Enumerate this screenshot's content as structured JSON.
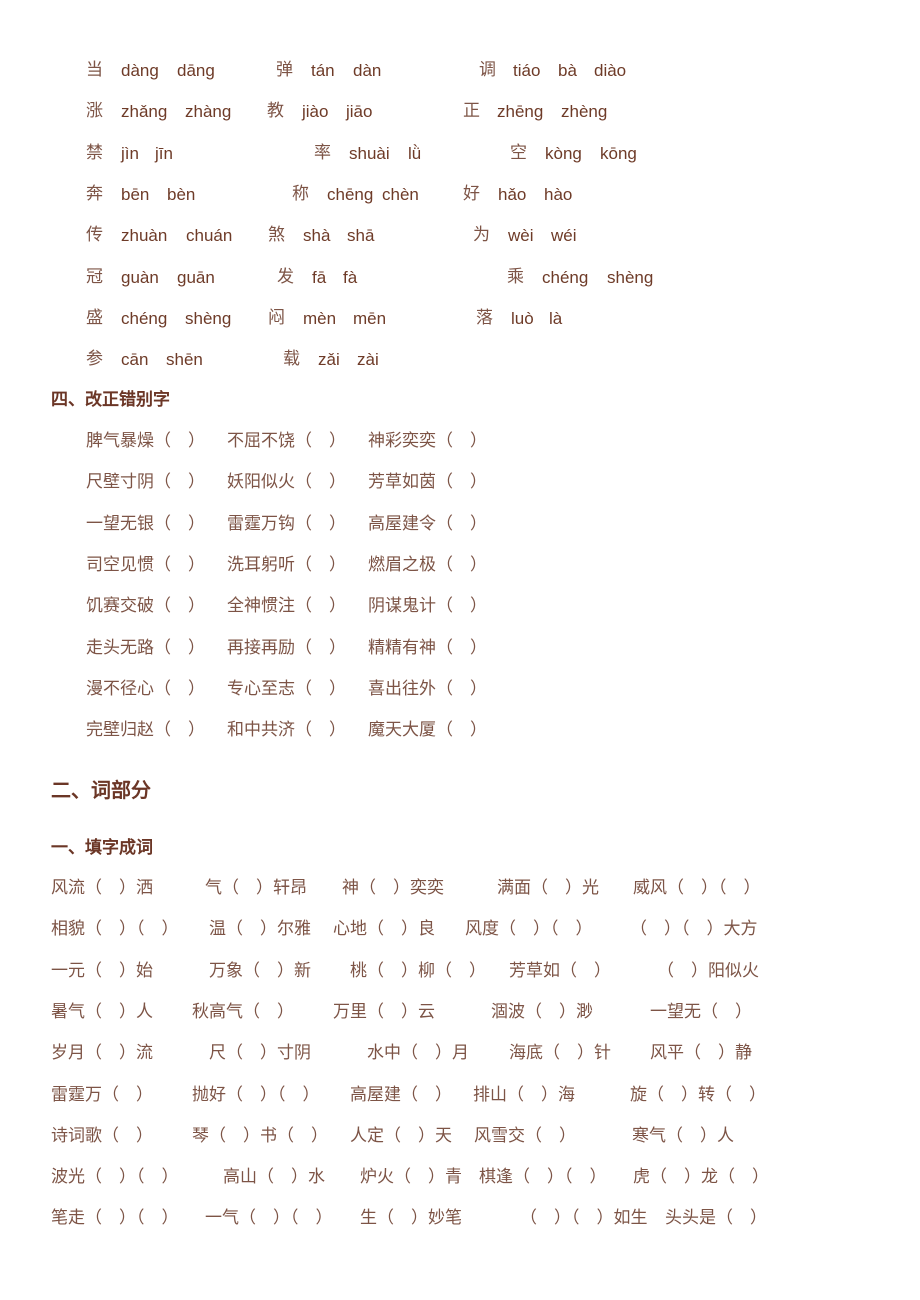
{
  "polyphones": [
    [
      {
        "char": "当",
        "pinyin": [
          "dàng",
          "dāng"
        ]
      },
      {
        "char": "弹",
        "pinyin": [
          "tán",
          "dàn"
        ]
      },
      {
        "char": "调",
        "pinyin": [
          "tiáo",
          "bà",
          "diào"
        ]
      }
    ],
    [
      {
        "char": "涨",
        "pinyin": [
          "zhǎng",
          "zhàng"
        ]
      },
      {
        "char": "教",
        "pinyin": [
          "jiào",
          "jiāo"
        ]
      },
      {
        "char": "正",
        "pinyin": [
          "zhēng",
          "zhèng"
        ]
      }
    ],
    [
      {
        "char": "禁",
        "pinyin": [
          "jìn",
          "jīn"
        ]
      },
      {
        "char": "率",
        "pinyin": [
          "shuài",
          "lǜ"
        ]
      },
      {
        "char": "空",
        "pinyin": [
          "kòng",
          "kōng"
        ]
      }
    ],
    [
      {
        "char": "奔",
        "pinyin": [
          "bēn",
          "bèn"
        ]
      },
      {
        "char": "称",
        "pinyin": [
          "chēng",
          "chèn"
        ]
      },
      {
        "char": "好",
        "pinyin": [
          "hǎo",
          "hào"
        ]
      }
    ],
    [
      {
        "char": "传",
        "pinyin": [
          "zhuàn",
          "chuán"
        ]
      },
      {
        "char": "煞",
        "pinyin": [
          "shà",
          "shā"
        ]
      },
      {
        "char": "为",
        "pinyin": [
          "wèi",
          "wéi"
        ]
      }
    ],
    [
      {
        "char": "冠",
        "pinyin": [
          "guàn",
          "guān"
        ]
      },
      {
        "char": "发",
        "pinyin": [
          "fā",
          "fà"
        ]
      },
      {
        "char": "乘",
        "pinyin": [
          "chéng",
          "shèng"
        ]
      }
    ],
    [
      {
        "char": "盛",
        "pinyin": [
          "chéng",
          "shèng"
        ]
      },
      {
        "char": "闷",
        "pinyin": [
          "mèn",
          "mēn"
        ]
      },
      {
        "char": "落",
        "pinyin": [
          "luò",
          "là"
        ]
      }
    ],
    [
      {
        "char": "参",
        "pinyin": [
          "cān",
          "shēn"
        ]
      },
      {
        "char": "载",
        "pinyin": [
          "zǎi",
          "zài"
        ]
      }
    ]
  ],
  "section_correct": {
    "title": "四、改正错别字",
    "rows": [
      [
        "脾气暴燥（　）",
        "不屈不饶（　）",
        "神彩奕奕（　）"
      ],
      [
        "尺壁寸阴（　）",
        "妖阳似火（　）",
        "芳草如茵（　）"
      ],
      [
        "一望无银（　）",
        "雷霆万钩（　）",
        "高屋建令（　）"
      ],
      [
        "司空见惯（　）",
        "洗耳躬听（　）",
        "燃眉之极（　）"
      ],
      [
        "饥赛交破（　）",
        "全神惯注（　）",
        "阴谋鬼计（　）"
      ],
      [
        "走头无路（　）",
        "再接再励（　）",
        "精精有神（　）"
      ],
      [
        "漫不径心（　）",
        "专心至志（　）",
        "喜出往外（　）"
      ],
      [
        "完壁归赵（　）",
        "和中共济（　）",
        "魔天大厦（　）"
      ]
    ]
  },
  "section_words": {
    "title": "二、词部分"
  },
  "section_fill": {
    "title": "一、填字成词",
    "rows": [
      [
        "风流（　）洒",
        "气（　）轩昂",
        "神（　）奕奕",
        "满面（　）光",
        "威风（　）（　）"
      ],
      [
        "相貌（　）（　）",
        "温（　）尔雅",
        "心地（　）良",
        "风度（　）（　）",
        "（　）（　）大方"
      ],
      [
        "一元（　）始",
        "万象（　）新",
        "桃（　）柳（　）",
        "芳草如（　）",
        "（　）阳似火"
      ],
      [
        "暑气（　）人",
        "秋高气（　）",
        "万里（　）云",
        "涸波（　）渺",
        "一望无（　）"
      ],
      [
        "岁月（　）流",
        "尺（　）寸阴",
        "水中（　）月",
        "海底（　）针",
        "风平（　）静"
      ],
      [
        "雷霆万（　）",
        "抛好（　）（　）",
        "高屋建（　）",
        "排山（　）海",
        "旋（　）转（　）"
      ],
      [
        "诗词歌（　）",
        "琴（　）书（　）",
        "人定（　）天",
        "风雪交（　）",
        "寒气（　）人"
      ],
      [
        "波光（　）（　）",
        "高山（　）水",
        "炉火（　）青",
        "棋逢（　）（　）",
        "虎（　）龙（　）"
      ],
      [
        "笔走（　）（　）",
        "一气（　）（　）",
        "生（　）妙笔",
        "（　）（　）如生",
        "头头是（　）"
      ]
    ]
  }
}
